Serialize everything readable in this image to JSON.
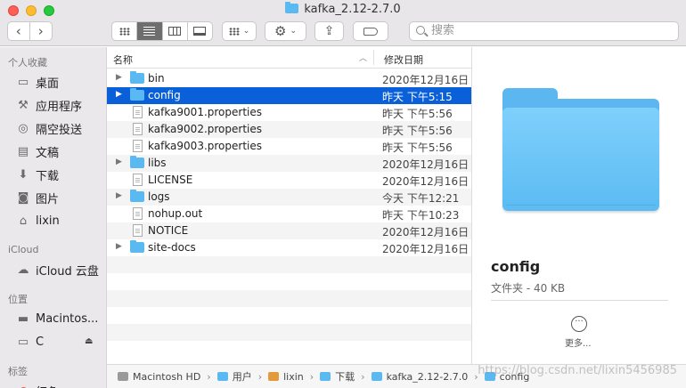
{
  "window": {
    "title": "kafka_2.12-2.7.0"
  },
  "toolbar": {
    "back": "‹",
    "forward": "›",
    "search_placeholder": "搜索"
  },
  "sidebar": {
    "sections": {
      "favorites": "个人收藏",
      "icloud": "iCloud",
      "locations": "位置",
      "tags": "标签"
    },
    "favorites": [
      {
        "label": "桌面",
        "icon": "desktop-icon"
      },
      {
        "label": "应用程序",
        "icon": "applications-icon"
      },
      {
        "label": "隔空投送",
        "icon": "airdrop-icon"
      },
      {
        "label": "文稿",
        "icon": "documents-icon"
      },
      {
        "label": "下载",
        "icon": "downloads-icon"
      },
      {
        "label": "图片",
        "icon": "pictures-icon"
      },
      {
        "label": "lixin",
        "icon": "home-icon"
      }
    ],
    "icloud": [
      {
        "label": "iCloud 云盘",
        "icon": "cloud-icon"
      }
    ],
    "locations": [
      {
        "label": "Macintos...",
        "icon": "disk-icon"
      },
      {
        "label": "C",
        "icon": "disk-icon"
      }
    ],
    "tags": [
      {
        "label": "红色",
        "color": "#fe4b4b"
      }
    ]
  },
  "list": {
    "headers": {
      "name": "名称",
      "date": "修改日期"
    },
    "rows": [
      {
        "name": "bin",
        "date": "2020年12月16日",
        "kind": "folder",
        "expandable": true
      },
      {
        "name": "config",
        "date": "昨天 下午5:15",
        "kind": "folder",
        "expandable": true,
        "selected": true
      },
      {
        "name": "kafka9001.properties",
        "date": "昨天 下午5:56",
        "kind": "file",
        "expandable": false
      },
      {
        "name": "kafka9002.properties",
        "date": "昨天 下午5:56",
        "kind": "file",
        "expandable": false
      },
      {
        "name": "kafka9003.properties",
        "date": "昨天 下午5:56",
        "kind": "file",
        "expandable": false
      },
      {
        "name": "libs",
        "date": "2020年12月16日",
        "kind": "folder",
        "expandable": true
      },
      {
        "name": "LICENSE",
        "date": "2020年12月16日",
        "kind": "file",
        "expandable": false
      },
      {
        "name": "logs",
        "date": "今天 下午12:21",
        "kind": "folder",
        "expandable": true
      },
      {
        "name": "nohup.out",
        "date": "昨天 下午10:23",
        "kind": "file",
        "expandable": false
      },
      {
        "name": "NOTICE",
        "date": "2020年12月16日",
        "kind": "file",
        "expandable": false
      },
      {
        "name": "site-docs",
        "date": "2020年12月16日",
        "kind": "folder",
        "expandable": true
      }
    ]
  },
  "preview": {
    "name": "config",
    "meta": "文件夹 - 40 KB",
    "more": "更多..."
  },
  "pathbar": [
    {
      "label": "Macintosh HD",
      "icon": "disk-icon"
    },
    {
      "label": "用户",
      "icon": "folder-icon"
    },
    {
      "label": "lixin",
      "icon": "home-icon"
    },
    {
      "label": "下载",
      "icon": "downloads-icon"
    },
    {
      "label": "kafka_2.12-2.7.0",
      "icon": "folder-icon"
    },
    {
      "label": "config",
      "icon": "folder-icon"
    }
  ],
  "watermark": "https://blog.csdn.net/lixin5456985",
  "colors": {
    "selection": "#0a60d8",
    "folder": "#5ab9f0"
  }
}
